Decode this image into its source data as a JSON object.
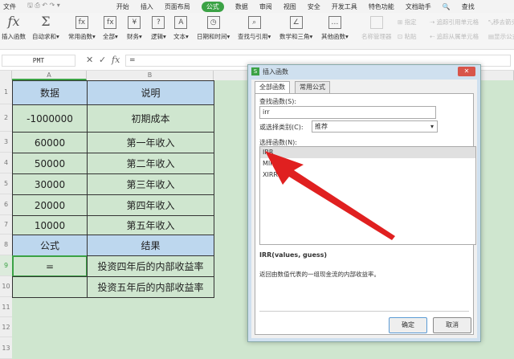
{
  "menu": {
    "file": "文件",
    "tabs": [
      "开始",
      "插入",
      "页面布局",
      "公式",
      "数据",
      "审阅",
      "视图",
      "安全",
      "开发工具",
      "特色功能",
      "文档助手"
    ],
    "search": "查找"
  },
  "ribbon": {
    "insert_fn": "插入函数",
    "autosum": "自动求和",
    "common": "常用函数",
    "all": "全部",
    "finance": "财务",
    "logic": "逻辑",
    "text": "文本",
    "datetime": "日期和时间",
    "lookup": "查找与引用",
    "math": "数学和三角",
    "other": "其他函数",
    "name_mgr": "名称管理器",
    "assign": "指定",
    "paste": "粘贴",
    "trace_prec": "追踪引用单元格",
    "trace_dep": "追踪从属单元格",
    "remove_arrows": "移去箭头",
    "show_formula": "显示公式"
  },
  "formula_bar": {
    "name_box": "PMT",
    "formula": "="
  },
  "columns": [
    "A",
    "B"
  ],
  "rows": [
    "1",
    "2",
    "3",
    "4",
    "5",
    "6",
    "7",
    "8",
    "9",
    "10",
    "11",
    "12",
    "13"
  ],
  "cells": [
    [
      "数据",
      "说明"
    ],
    [
      "-1000000",
      "初期成本"
    ],
    [
      "60000",
      "第一年收入"
    ],
    [
      "50000",
      "第二年收入"
    ],
    [
      "30000",
      "第三年收入"
    ],
    [
      "20000",
      "第四年收入"
    ],
    [
      "10000",
      "第五年收入"
    ],
    [
      "公式",
      "结果"
    ],
    [
      "=",
      "投资四年后的内部收益率"
    ],
    [
      "",
      "投资五年后的内部收益率"
    ]
  ],
  "dialog": {
    "title": "插入函数",
    "tabs": [
      "全部函数",
      "常用公式"
    ],
    "search_label": "查找函数(S):",
    "search_value": "irr",
    "category_label": "或选择类别(C):",
    "category_value": "推荐",
    "select_label": "选择函数(N):",
    "functions": [
      "IRR",
      "MIRR",
      "XIRR"
    ],
    "signature": "IRR(values, guess)",
    "description": "返回由数值代表的一组现金流的内部收益率。",
    "ok": "确定",
    "cancel": "取消"
  },
  "colors": {
    "accent": "#3ba245",
    "sheet_bg": "#cfe6cf",
    "header_fill": "#bdd7ee",
    "arrow": "#e02020"
  }
}
